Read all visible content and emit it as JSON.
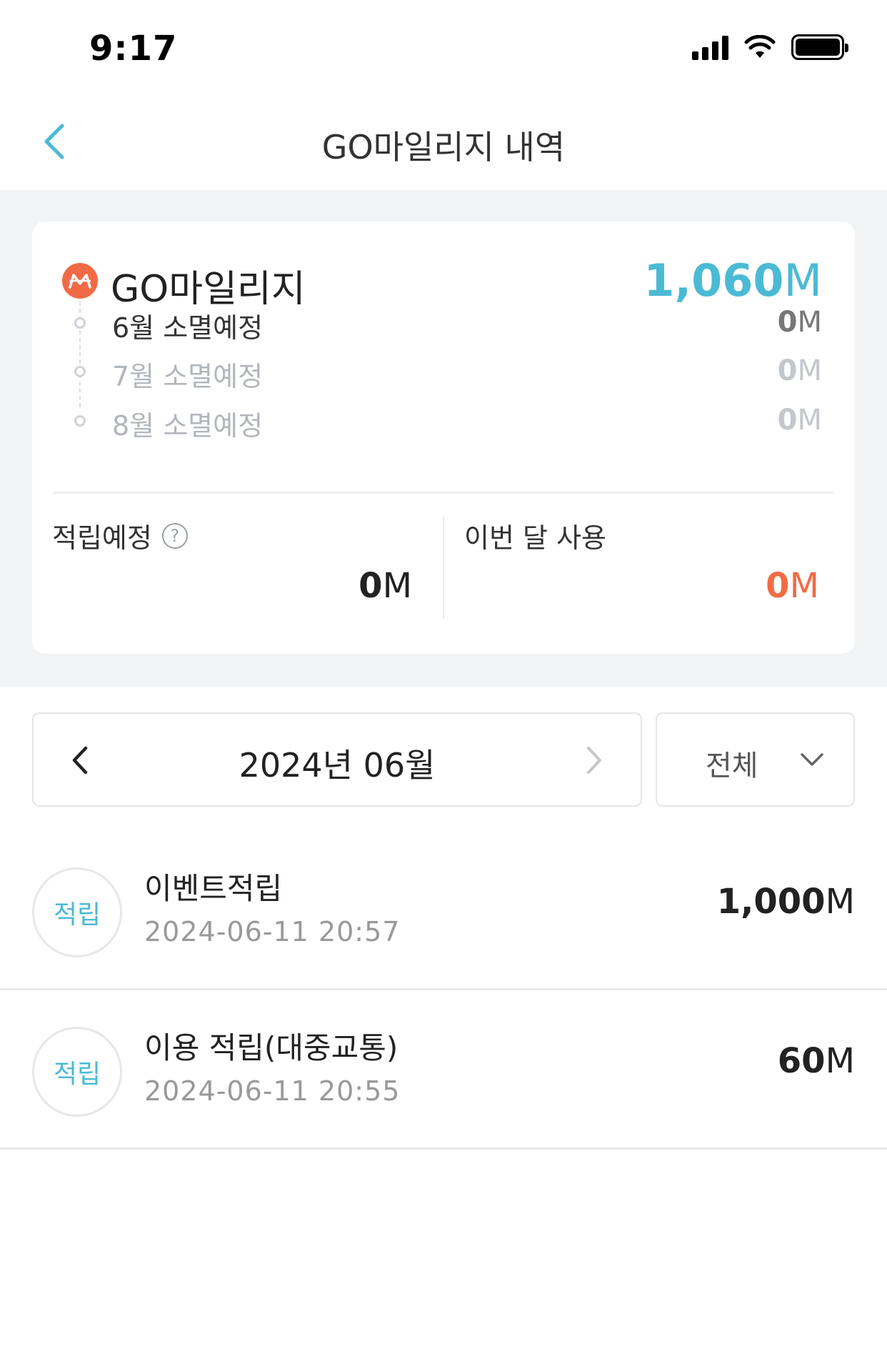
{
  "status_bar": {
    "time": "9:17"
  },
  "header": {
    "title": "GO마일리지 내역"
  },
  "summary": {
    "mileage_label": "GO마일리지",
    "total_value": "1,060",
    "unit": "M",
    "expirations": [
      {
        "label": "6월 소멸예정",
        "value": "0"
      },
      {
        "label": "7월 소멸예정",
        "value": "0"
      },
      {
        "label": "8월 소멸예정",
        "value": "0"
      }
    ],
    "pending_label": "적립예정",
    "pending_value": "0",
    "used_label": "이번 달 사용",
    "used_value": "0"
  },
  "month_selector": {
    "label": "2024년 06월"
  },
  "filter": {
    "label": "전체"
  },
  "transactions": [
    {
      "badge": "적립",
      "name": "이벤트적립",
      "date": "2024-06-11 20:57",
      "amount": "1,000"
    },
    {
      "badge": "적립",
      "name": "이용 적립(대중교통)",
      "date": "2024-06-11 20:55",
      "amount": "60"
    }
  ],
  "colors": {
    "accent": "#4bbad4",
    "highlight": "#f26a45",
    "background": "#f2f3f5"
  }
}
